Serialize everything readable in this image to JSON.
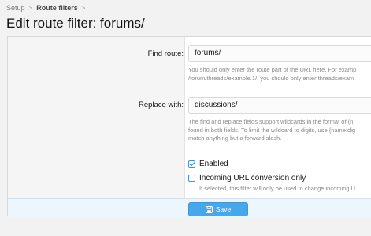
{
  "breadcrumb": {
    "items": [
      "Setup",
      "Route filters"
    ],
    "separator": ">"
  },
  "page": {
    "title": "Edit route filter: forums/"
  },
  "form": {
    "find_route": {
      "label": "Find route:",
      "value": "forums/",
      "explain": [
        "You should only enter the route part of the URL here. For examp",
        "/forum/threads/example.1/, you should only enter threads/exam"
      ]
    },
    "replace_with": {
      "label": "Replace with:",
      "value": "discussions/",
      "explain": [
        "The find and replace fields support wildcards in the format of {n",
        "found in both fields. To limit the wildcard to digits, use {name:dig",
        "match anything but a forward slash."
      ]
    },
    "enabled": {
      "label": "Enabled",
      "checked": true
    },
    "incoming_only": {
      "label": "Incoming URL conversion only",
      "checked": false,
      "hint": "If selected, this filter will only be used to change incoming U"
    },
    "save_label": "Save"
  },
  "colors": {
    "accent": "#47a7eb",
    "submit_row": "#edf5fd",
    "checkbox": "#2577c7"
  },
  "icons": {
    "save": "floppy-disk-icon",
    "breadcrumb_sep": "chevron-right-icon"
  }
}
